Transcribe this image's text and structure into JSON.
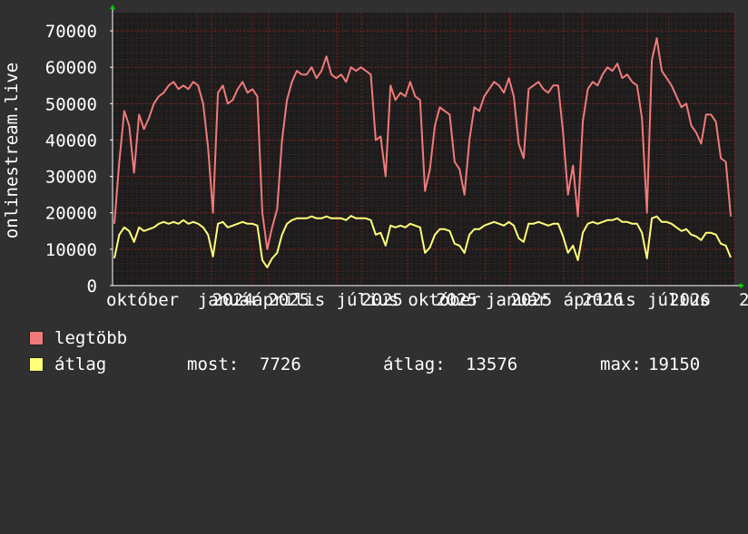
{
  "chart_data": {
    "type": "line",
    "ylabel": "onlinestream.live",
    "ylim": [
      0,
      75000
    ],
    "y_ticks": [
      0,
      10000,
      20000,
      30000,
      40000,
      50000,
      60000,
      70000
    ],
    "y_tick_labels": [
      "0",
      "10000",
      "20000",
      "30000",
      "40000",
      "50000",
      "60000",
      "70000"
    ],
    "x_tick_labels": [
      "október",
      "január",
      "2024",
      "április",
      "2025",
      "július",
      "2025",
      "október",
      "2025",
      "január",
      "2025",
      "április",
      "2026",
      "július",
      "2026",
      "2"
    ],
    "x_tick_positions": [
      0.0,
      0.137,
      0.16,
      0.225,
      0.25,
      0.36,
      0.4,
      0.475,
      0.52,
      0.6,
      0.64,
      0.725,
      0.755,
      0.86,
      0.895,
      1.0
    ],
    "grid": true,
    "series": [
      {
        "name": "legtöbb",
        "color": "#f07a7a",
        "values": [
          17000,
          34000,
          48000,
          44000,
          31000,
          47000,
          43000,
          46000,
          50000,
          52000,
          53000,
          55000,
          56000,
          54000,
          55000,
          54000,
          56000,
          55000,
          50000,
          38000,
          20000,
          53000,
          55000,
          50000,
          51000,
          54000,
          56000,
          53000,
          54000,
          52000,
          20000,
          10000,
          16000,
          21000,
          40000,
          51000,
          56000,
          59000,
          58000,
          58000,
          60000,
          57000,
          59000,
          63000,
          58000,
          57000,
          58000,
          56000,
          60000,
          59000,
          60000,
          59000,
          58000,
          40000,
          41000,
          30000,
          55000,
          51000,
          53000,
          52000,
          56000,
          52000,
          51000,
          26000,
          32000,
          44000,
          49000,
          48000,
          47000,
          34000,
          32000,
          25000,
          40000,
          49000,
          48000,
          52000,
          54000,
          56000,
          55000,
          53000,
          57000,
          52000,
          39000,
          35000,
          54000,
          55000,
          56000,
          54000,
          53000,
          55000,
          55000,
          42000,
          25000,
          33000,
          19000,
          45000,
          54000,
          56000,
          55000,
          58000,
          60000,
          59000,
          61000,
          57000,
          58000,
          56000,
          55000,
          46000,
          20000,
          62000,
          68000,
          59000,
          57000,
          55000,
          52000,
          49000,
          50000,
          44000,
          42000,
          39000,
          47000,
          47000,
          45000,
          35000,
          34000,
          19000
        ],
        "last_value": 18000
      },
      {
        "name": "átlag",
        "color": "#ffff7a",
        "values": [
          7500,
          14000,
          16000,
          15000,
          12000,
          16000,
          15000,
          15500,
          16000,
          17000,
          17500,
          17000,
          17500,
          17000,
          18000,
          17000,
          17500,
          17000,
          16000,
          14000,
          8000,
          17000,
          17500,
          16000,
          16500,
          17000,
          17500,
          17000,
          17000,
          16500,
          7000,
          5000,
          7500,
          9000,
          14000,
          17000,
          18000,
          18500,
          18500,
          18500,
          19000,
          18500,
          18500,
          19000,
          18500,
          18500,
          18500,
          18000,
          19150,
          18500,
          18500,
          18500,
          18000,
          14000,
          14500,
          11000,
          16500,
          16000,
          16500,
          16000,
          17000,
          16500,
          16000,
          9000,
          10500,
          14000,
          15500,
          15500,
          15000,
          11500,
          11000,
          9000,
          14000,
          15500,
          15500,
          16500,
          17000,
          17500,
          17000,
          16500,
          17500,
          16500,
          13000,
          12000,
          17000,
          17000,
          17500,
          17000,
          16500,
          17000,
          17000,
          13500,
          9000,
          11000,
          7000,
          14500,
          17000,
          17500,
          17000,
          17500,
          18000,
          18000,
          18500,
          17500,
          17500,
          17000,
          17000,
          14500,
          7500,
          18500,
          19000,
          17500,
          17500,
          17000,
          16000,
          15000,
          15500,
          14000,
          13500,
          12500,
          14500,
          14500,
          14000,
          11500,
          11000,
          7726
        ],
        "last_value": 7726
      }
    ],
    "stats": {
      "most_label": "most:",
      "most_value": "7726",
      "avg_label": "átlag:",
      "avg_value": "13576",
      "max_label": "max:",
      "max_value": "19150"
    }
  },
  "colors": {
    "background": "#303030",
    "plot_background": "#1c1c1c",
    "grid_major": "#7a2020",
    "grid_minor": "#4a2a2a",
    "axis_arrow": "#00cc00",
    "text": "#ffffff"
  }
}
